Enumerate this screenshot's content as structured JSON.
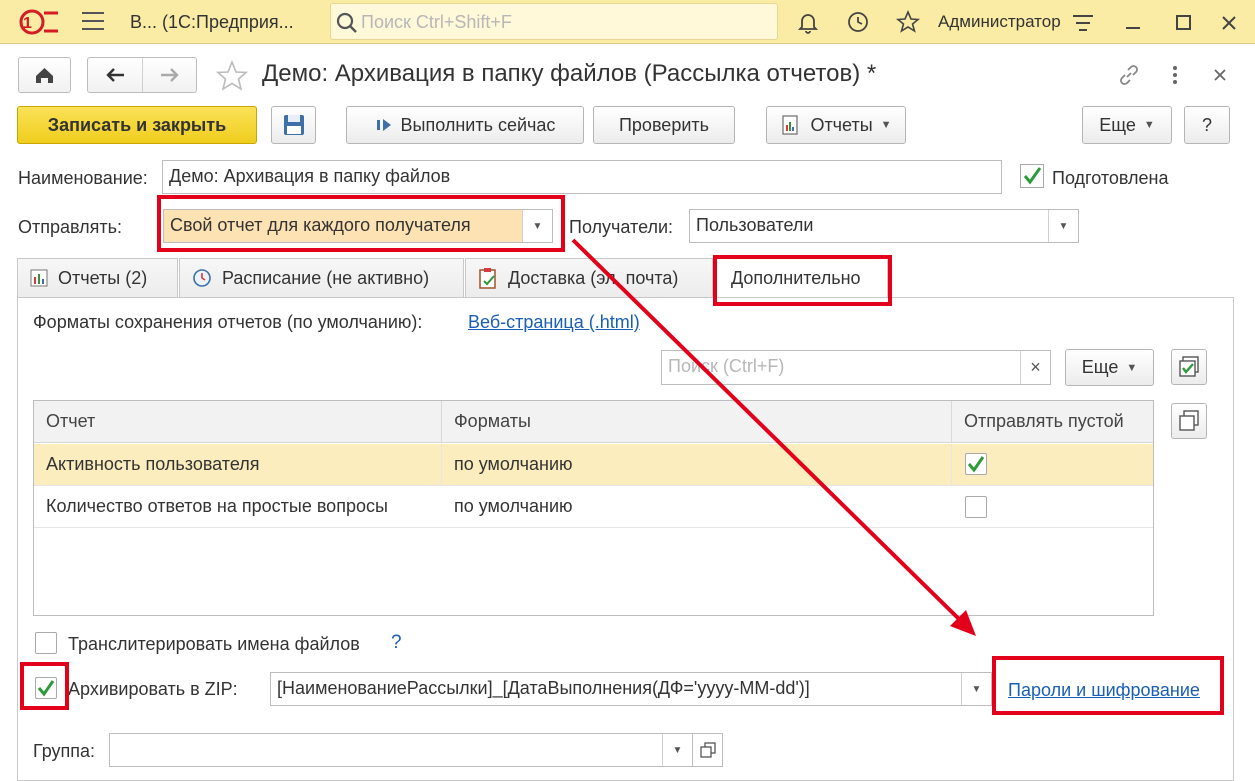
{
  "appbar": {
    "logo": "1С",
    "title": "В...   (1С:Предприя...",
    "search_placeholder": "Поиск Ctrl+Shift+F",
    "user": "Администратор",
    "icons": [
      "hamburger-icon",
      "search-icon",
      "bell-icon",
      "history-icon",
      "star-icon",
      "settings-icon",
      "minimize-icon",
      "maximize-icon",
      "close-icon"
    ]
  },
  "window": {
    "title": "Демо: Архивация в папку файлов (Рассылка отчетов) *"
  },
  "toolbar": {
    "save_close": "Записать и закрыть",
    "run_now": "Выполнить сейчас",
    "check": "Проверить",
    "reports": "Отчеты",
    "more": "Еще",
    "help": "?"
  },
  "form": {
    "name_label": "Наименование:",
    "name_value": "Демо: Архивация в папку файлов",
    "prepared_label": "Подготовлена",
    "send_label": "Отправлять:",
    "send_value": "Свой отчет для каждого получателя",
    "recipients_label": "Получатели:",
    "recipients_value": "Пользователи"
  },
  "tabs": [
    {
      "label": "Отчеты (2)"
    },
    {
      "label": "Расписание (не активно)"
    },
    {
      "label": "Доставка (эл. почта)"
    },
    {
      "label": "Дополнительно"
    }
  ],
  "extra": {
    "formats_label": "Форматы сохранения отчетов (по умолчанию):",
    "formats_link": "Веб-страница (.html)",
    "search_placeholder": "Поиск (Ctrl+F)",
    "clear": "×",
    "more": "Еще",
    "table": {
      "headers": [
        "Отчет",
        "Форматы",
        "Отправлять пустой"
      ],
      "rows": [
        {
          "report": "Активность пользователя",
          "formats": "по умолчанию",
          "send_empty": true
        },
        {
          "report": "Количество ответов на простые вопросы",
          "formats": "по умолчанию",
          "send_empty": false
        }
      ]
    },
    "transliterate_label": "Транслитерировать имена файлов",
    "transliterate_help": "?",
    "zip_label": "Архивировать в ZIP:",
    "zip_value": "[НаименованиеРассылки]_[ДатаВыполнения(ДФ='yyyy-MM-dd')]",
    "passwords_link": "Пароли и шифрование",
    "group_label": "Группа:",
    "group_value": ""
  },
  "colors": {
    "appbar": "#fbeca5",
    "primary_button": "#f3d42a",
    "selected_row": "#fbedbe",
    "highlight_field": "#fde2b4",
    "annotation": "#e3001b",
    "link": "#1a5fb4",
    "check": "#2e9a3a"
  }
}
